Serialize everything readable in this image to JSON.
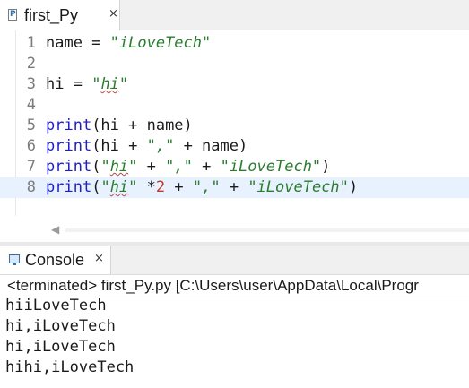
{
  "editor_tab": {
    "label": "first_Py",
    "close": "×",
    "icon": "python-file-icon",
    "icon_glyph": "P"
  },
  "code_lines": [
    {
      "line": "1",
      "tokens": [
        {
          "t": "name = "
        },
        {
          "t": "\"iLoveTech\"",
          "c": "str"
        }
      ]
    },
    {
      "line": "2",
      "tokens": []
    },
    {
      "line": "3",
      "tokens": [
        {
          "t": "hi = "
        },
        {
          "t": "\"",
          "c": "str"
        },
        {
          "t": "hi",
          "c": "str squig"
        },
        {
          "t": "\"",
          "c": "str"
        }
      ]
    },
    {
      "line": "4",
      "tokens": []
    },
    {
      "line": "5",
      "tokens": [
        {
          "t": "print",
          "c": "kw"
        },
        {
          "t": "(hi + name)"
        }
      ]
    },
    {
      "line": "6",
      "tokens": [
        {
          "t": "print",
          "c": "kw"
        },
        {
          "t": "(hi + "
        },
        {
          "t": "\",\"",
          "c": "str"
        },
        {
          "t": " + name)"
        }
      ]
    },
    {
      "line": "7",
      "tokens": [
        {
          "t": "print",
          "c": "kw"
        },
        {
          "t": "("
        },
        {
          "t": "\"",
          "c": "str"
        },
        {
          "t": "hi",
          "c": "str squig"
        },
        {
          "t": "\"",
          "c": "str"
        },
        {
          "t": " + "
        },
        {
          "t": "\",\"",
          "c": "str"
        },
        {
          "t": " + "
        },
        {
          "t": "\"iLoveTech\"",
          "c": "str"
        },
        {
          "t": ")"
        }
      ]
    },
    {
      "line": "8",
      "current": true,
      "tokens": [
        {
          "t": "print",
          "c": "kw"
        },
        {
          "t": "("
        },
        {
          "t": "\"",
          "c": "str"
        },
        {
          "t": "hi",
          "c": "str squig"
        },
        {
          "t": "\"",
          "c": "str"
        },
        {
          "t": " *"
        },
        {
          "t": "2",
          "c": "num"
        },
        {
          "t": " + "
        },
        {
          "t": "\",\"",
          "c": "str"
        },
        {
          "t": " + "
        },
        {
          "t": "\"iLoveTech\"",
          "c": "str"
        },
        {
          "t": ")"
        }
      ]
    }
  ],
  "console_tab": {
    "label": "Console",
    "close": "×",
    "icon": "console-icon"
  },
  "console_status": "<terminated> first_Py.py [C:\\Users\\user\\AppData\\Local\\Progr",
  "console_output": [
    "hiiLoveTech",
    "hi,iLoveTech",
    "hi,iLoveTech",
    "hihi,iLoveTech"
  ],
  "scroll_arrow": "◀"
}
